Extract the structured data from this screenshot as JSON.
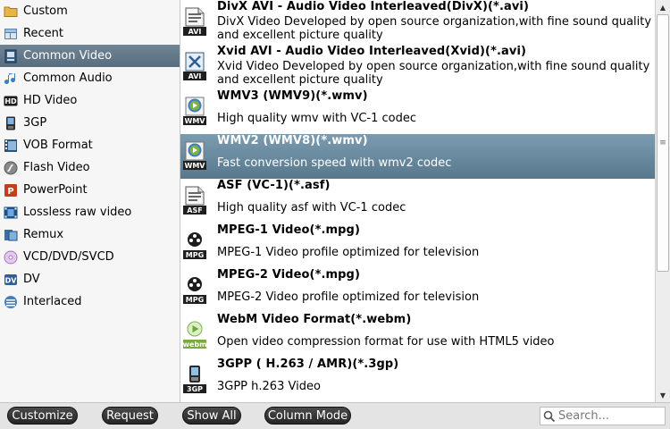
{
  "sidebar": {
    "items": [
      {
        "label": "Custom",
        "icon": "folder-icon",
        "active": false
      },
      {
        "label": "Recent",
        "icon": "recent-grid-icon",
        "active": false
      },
      {
        "label": "Common Video",
        "icon": "video-file-icon",
        "active": true
      },
      {
        "label": "Common Audio",
        "icon": "music-note-icon",
        "active": false
      },
      {
        "label": "HD Video",
        "icon": "hd-icon",
        "active": false
      },
      {
        "label": "3GP",
        "icon": "phone-icon",
        "active": false
      },
      {
        "label": "VOB Format",
        "icon": "film-strip-icon",
        "active": false
      },
      {
        "label": "Flash Video",
        "icon": "flash-icon",
        "active": false
      },
      {
        "label": "PowerPoint",
        "icon": "powerpoint-icon",
        "active": false
      },
      {
        "label": "Lossless raw video",
        "icon": "raw-film-icon",
        "active": false
      },
      {
        "label": "Remux",
        "icon": "remux-icon",
        "active": false
      },
      {
        "label": "VCD/DVD/SVCD",
        "icon": "disc-icon",
        "active": false
      },
      {
        "label": "DV",
        "icon": "dv-icon",
        "active": false
      },
      {
        "label": "Interlaced",
        "icon": "interlaced-icon",
        "active": false
      }
    ]
  },
  "formats": {
    "items": [
      {
        "title": "DivX AVI - Audio Video Interleaved(DivX)(*.avi)",
        "desc": "DivX Video Developed by open source organization,with fine sound quality and excellent picture quality",
        "badge": "AVI",
        "icon": "avi-file-icon",
        "selected": false
      },
      {
        "title": "Xvid AVI - Audio Video Interleaved(Xvid)(*.avi)",
        "desc": "Xvid Video Developed by open source organization,with fine sound quality and excellent picture quality",
        "badge": "AVI",
        "icon": "xvid-file-icon",
        "selected": false
      },
      {
        "title": "WMV3 (WMV9)(*.wmv)",
        "desc": "High quality wmv with VC-1 codec",
        "badge": "WMV",
        "icon": "wmv-file-icon",
        "selected": false
      },
      {
        "title": "WMV2 (WMV8)(*.wmv)",
        "desc": "Fast conversion speed with wmv2 codec",
        "badge": "WMV",
        "icon": "wmv-file-icon",
        "selected": true
      },
      {
        "title": "ASF (VC-1)(*.asf)",
        "desc": "High quality asf with VC-1 codec",
        "badge": "ASF",
        "icon": "asf-file-icon",
        "selected": false
      },
      {
        "title": "MPEG-1 Video(*.mpg)",
        "desc": "MPEG-1 Video profile optimized for television",
        "badge": "MPG",
        "icon": "film-reel-icon",
        "selected": false
      },
      {
        "title": "MPEG-2 Video(*.mpg)",
        "desc": "MPEG-2 Video profile optimized for television",
        "badge": "MPG",
        "icon": "film-reel-icon",
        "selected": false
      },
      {
        "title": "WebM Video Format(*.webm)",
        "desc": "Open video compression format for use with HTML5 video",
        "badge": "webm",
        "icon": "webm-play-icon",
        "selected": false
      },
      {
        "title": "3GPP ( H.263 / AMR)(*.3gp)",
        "desc": "3GPP h.263 Video",
        "badge": "3GP",
        "icon": "3gp-phone-icon",
        "selected": false
      }
    ]
  },
  "toolbar": {
    "customize_label": "Customize",
    "request_label": "Request",
    "show_all_label": "Show All",
    "column_mode_label": "Column Mode"
  },
  "search": {
    "placeholder": "Search..."
  },
  "colors": {
    "sidebar_active": "#627788",
    "list_selected": "#6a8aa0",
    "button_dark": "#333333"
  }
}
